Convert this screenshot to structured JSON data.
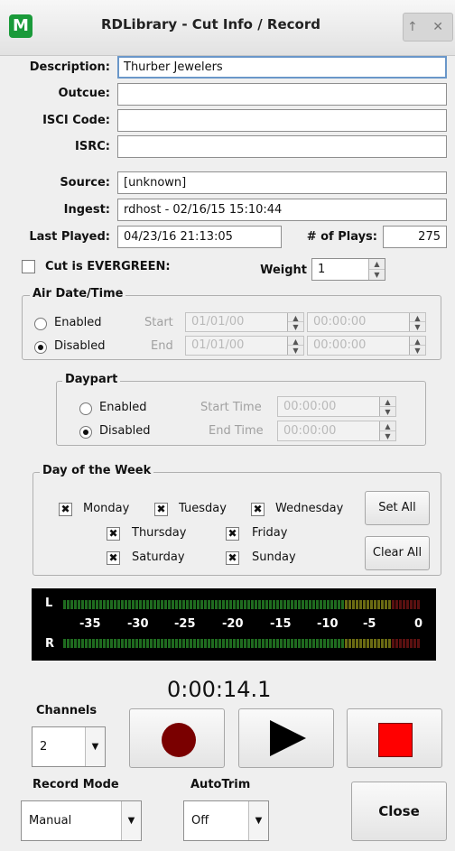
{
  "window": {
    "title": "RDLibrary - Cut Info / Record",
    "logo": "M",
    "controls": "↑ ✕"
  },
  "form": {
    "description_label": "Description:",
    "description_value": "Thurber Jewelers",
    "outcue_label": "Outcue:",
    "outcue_value": "",
    "isci_label": "ISCI Code:",
    "isci_value": "",
    "isrc_label": "ISRC:",
    "isrc_value": "",
    "source_label": "Source:",
    "source_value": "[unknown]",
    "ingest_label": "Ingest:",
    "ingest_value": "rdhost - 02/16/15 15:10:44",
    "last_played_label": "Last Played:",
    "last_played_value": "04/23/16 21:13:05",
    "plays_label": "# of Plays:",
    "plays_value": "275",
    "evergreen_label": "Cut is EVERGREEN:",
    "evergreen_checked": false,
    "weight_label": "Weight",
    "weight_value": "1"
  },
  "air_date": {
    "title": "Air Date/Time",
    "enabled_label": "Enabled",
    "disabled_label": "Disabled",
    "selected": "Disabled",
    "start_label": "Start",
    "end_label": "End",
    "start_date": "01/01/00",
    "start_time": "00:00:00",
    "end_date": "01/01/00",
    "end_time": "00:00:00"
  },
  "daypart": {
    "title": "Daypart",
    "enabled_label": "Enabled",
    "disabled_label": "Disabled",
    "selected": "Disabled",
    "start_label": "Start Time",
    "end_label": "End Time",
    "start_time": "00:00:00",
    "end_time": "00:00:00"
  },
  "days": {
    "title": "Day of the Week",
    "monday": "Monday",
    "tuesday": "Tuesday",
    "wednesday": "Wednesday",
    "thursday": "Thursday",
    "friday": "Friday",
    "saturday": "Saturday",
    "sunday": "Sunday",
    "set_all": "Set All",
    "clear_all": "Clear All",
    "check_mark": "✖"
  },
  "meter": {
    "left_label": "L",
    "right_label": "R",
    "scale": [
      "-35",
      "-30",
      "-25",
      "-20",
      "-15",
      "-10",
      "-5",
      "0"
    ],
    "colors": {
      "green": "#1f6b1f",
      "yellow": "#6b6b12",
      "red": "#5a1010"
    }
  },
  "transport": {
    "time": "0:00:14.1",
    "channels_label": "Channels",
    "channels_value": "2",
    "record_mode_label": "Record Mode",
    "record_mode_value": "Manual",
    "autotrim_label": "AutoTrim",
    "autotrim_value": "Off",
    "close_label": "Close",
    "record_color": "#7a0000",
    "stop_color": "#ff0000"
  }
}
